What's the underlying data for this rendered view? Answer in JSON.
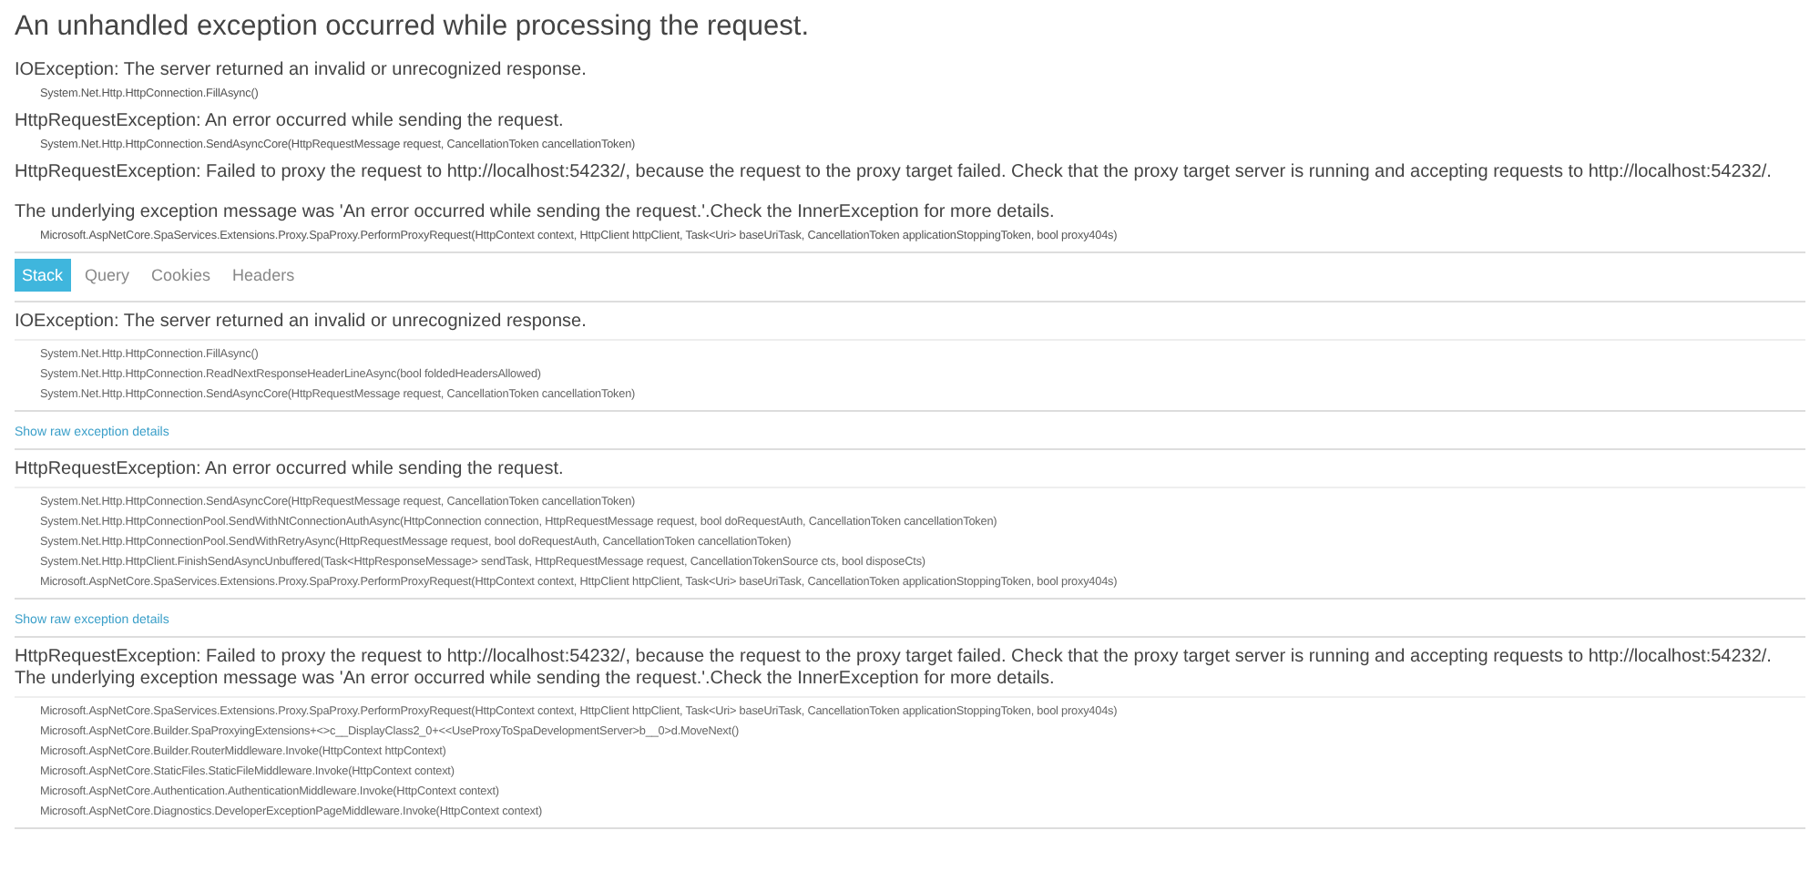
{
  "title": "An unhandled exception occurred while processing the request.",
  "summary": [
    {
      "message": "IOException: The server returned an invalid or unrecognized response.",
      "frames": [
        "System.Net.Http.HttpConnection.FillAsync()"
      ]
    },
    {
      "message": "HttpRequestException: An error occurred while sending the request.",
      "frames": [
        "System.Net.Http.HttpConnection.SendAsyncCore(HttpRequestMessage request, CancellationToken cancellationToken)"
      ]
    },
    {
      "message": "HttpRequestException: Failed to proxy the request to http://localhost:54232/, because the request to the proxy target failed. Check that the proxy target server is running and accepting requests to http://localhost:54232/."
    },
    {
      "message": "The underlying exception message was 'An error occurred while sending the request.'.Check the InnerException for more details.",
      "frames": [
        "Microsoft.AspNetCore.SpaServices.Extensions.Proxy.SpaProxy.PerformProxyRequest(HttpContext context, HttpClient httpClient, Task<Uri> baseUriTask, CancellationToken applicationStoppingToken, bool proxy404s)"
      ]
    }
  ],
  "tabs": [
    {
      "label": "Stack",
      "selected": true
    },
    {
      "label": "Query",
      "selected": false
    },
    {
      "label": "Cookies",
      "selected": false
    },
    {
      "label": "Headers",
      "selected": false
    }
  ],
  "stack": [
    {
      "message": "IOException: The server returned an invalid or unrecognized response.",
      "frames": [
        "System.Net.Http.HttpConnection.FillAsync()",
        "System.Net.Http.HttpConnection.ReadNextResponseHeaderLineAsync(bool foldedHeadersAllowed)",
        "System.Net.Http.HttpConnection.SendAsyncCore(HttpRequestMessage request, CancellationToken cancellationToken)"
      ],
      "link": "Show raw exception details"
    },
    {
      "message": "HttpRequestException: An error occurred while sending the request.",
      "frames": [
        "System.Net.Http.HttpConnection.SendAsyncCore(HttpRequestMessage request, CancellationToken cancellationToken)",
        "System.Net.Http.HttpConnectionPool.SendWithNtConnectionAuthAsync(HttpConnection connection, HttpRequestMessage request, bool doRequestAuth, CancellationToken cancellationToken)",
        "System.Net.Http.HttpConnectionPool.SendWithRetryAsync(HttpRequestMessage request, bool doRequestAuth, CancellationToken cancellationToken)",
        "System.Net.Http.HttpClient.FinishSendAsyncUnbuffered(Task<HttpResponseMessage> sendTask, HttpRequestMessage request, CancellationTokenSource cts, bool disposeCts)",
        "Microsoft.AspNetCore.SpaServices.Extensions.Proxy.SpaProxy.PerformProxyRequest(HttpContext context, HttpClient httpClient, Task<Uri> baseUriTask, CancellationToken applicationStoppingToken, bool proxy404s)"
      ],
      "link": "Show raw exception details"
    },
    {
      "message": "HttpRequestException: Failed to proxy the request to http://localhost:54232/, because the request to the proxy target failed. Check that the proxy target server is running and accepting requests to http://localhost:54232/. The underlying exception message was 'An error occurred while sending the request.'.Check the InnerException for more details.",
      "frames": [
        "Microsoft.AspNetCore.SpaServices.Extensions.Proxy.SpaProxy.PerformProxyRequest(HttpContext context, HttpClient httpClient, Task<Uri> baseUriTask, CancellationToken applicationStoppingToken, bool proxy404s)",
        "Microsoft.AspNetCore.Builder.SpaProxyingExtensions+<>c__DisplayClass2_0+<<UseProxyToSpaDevelopmentServer>b__0>d.MoveNext()",
        "Microsoft.AspNetCore.Builder.RouterMiddleware.Invoke(HttpContext httpContext)",
        "Microsoft.AspNetCore.StaticFiles.StaticFileMiddleware.Invoke(HttpContext context)",
        "Microsoft.AspNetCore.Authentication.AuthenticationMiddleware.Invoke(HttpContext context)",
        "Microsoft.AspNetCore.Diagnostics.DeveloperExceptionPageMiddleware.Invoke(HttpContext context)"
      ]
    }
  ]
}
